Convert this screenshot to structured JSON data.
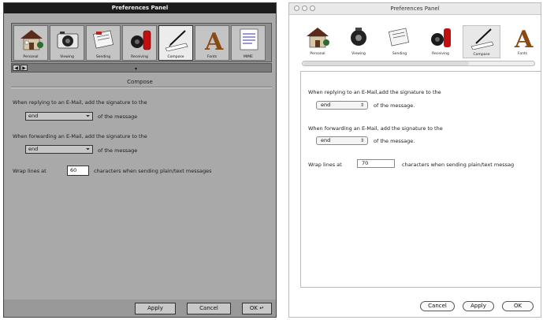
{
  "left_window": {
    "title": "Preferences Panel",
    "tools": [
      {
        "label": "Personal",
        "icon": "house-icon"
      },
      {
        "label": "Viewing",
        "icon": "camera-icon"
      },
      {
        "label": "Sending",
        "icon": "mail-send-icon"
      },
      {
        "label": "Receiving",
        "icon": "mailbox-icon"
      },
      {
        "label": "Compose",
        "icon": "pen-paper-icon",
        "selected": true
      },
      {
        "label": "Fonts",
        "icon": "font-a-icon"
      },
      {
        "label": "MIME",
        "icon": "document-icon"
      }
    ],
    "section_title": "Compose",
    "reply_text": "When replying to an E-Mail, add the signature to the",
    "reply_value": "end",
    "reply_suffix": "of the message",
    "forward_text": "When forwarding an E-Mail, add the signature to the",
    "forward_value": "end",
    "forward_suffix": "of the message",
    "wrap_prefix": "Wrap lines at",
    "wrap_value": "60",
    "wrap_suffix": "characters when sending plain/text messages",
    "buttons": {
      "apply": "Apply",
      "cancel": "Cancel",
      "ok": "OK"
    }
  },
  "right_window": {
    "title": "Preferences Panel",
    "tools": [
      {
        "label": "Personal",
        "icon": "house-icon"
      },
      {
        "label": "Viewing",
        "icon": "camera-icon"
      },
      {
        "label": "Sending",
        "icon": "mail-send-icon"
      },
      {
        "label": "Receiving",
        "icon": "mailbox-icon"
      },
      {
        "label": "Compose",
        "icon": "pen-paper-icon",
        "selected": true
      },
      {
        "label": "Fonts",
        "icon": "font-a-icon"
      }
    ],
    "reply_text": "When replying to an E-Mail,add the signature to the",
    "reply_value": "end",
    "reply_suffix": "of the message.",
    "forward_text": "When forwarding an E-Mail, add the signature to the",
    "forward_value": "end",
    "forward_suffix": "of the message.",
    "wrap_prefix": "Wrap lines at",
    "wrap_value": "70",
    "wrap_suffix": "characters when sending plain/text messag",
    "buttons": {
      "cancel": "Cancel",
      "apply": "Apply",
      "ok": "OK"
    }
  },
  "colors": {
    "next_gray": "#a9a9a9",
    "next_title": "#1c1c1c",
    "aqua_white": "#ffffff"
  }
}
